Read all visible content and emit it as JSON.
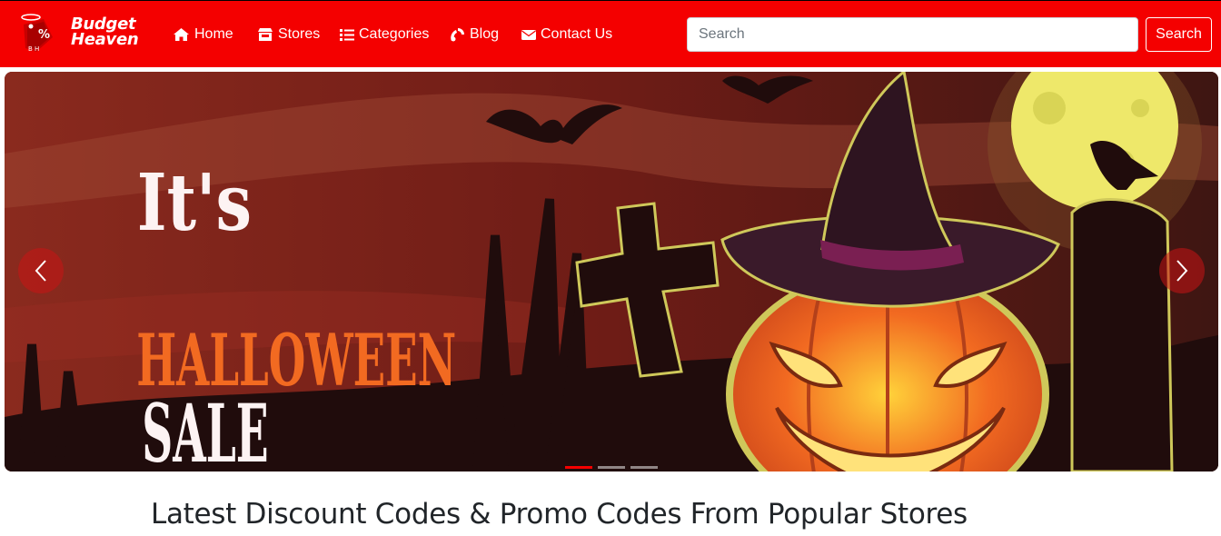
{
  "brand": {
    "line1": "Budget",
    "line2": "Heaven",
    "badge_symbol": "%",
    "badge_initials": "B H"
  },
  "nav": {
    "items": [
      {
        "label": "Home",
        "icon": "home-icon"
      },
      {
        "label": "Stores",
        "icon": "store-icon"
      },
      {
        "label": "Categories",
        "icon": "list-icon"
      },
      {
        "label": "Blog",
        "icon": "blog-icon"
      },
      {
        "label": "Contact Us",
        "icon": "envelope-icon"
      }
    ]
  },
  "search": {
    "placeholder": "Search",
    "value": "",
    "button_label": "Search"
  },
  "carousel": {
    "slide_text": {
      "line1": "It's",
      "line2": "HALLOWEEN",
      "line3": "SALE"
    },
    "prev_icon": "chevron-left-icon",
    "next_icon": "chevron-right-icon",
    "indicator_count": 3,
    "active_index": 0
  },
  "main": {
    "heading": "Latest Discount Codes & Promo Codes From Popular Stores"
  },
  "colors": {
    "brand_red": "#f40000",
    "slide_orange": "#f26a21",
    "slide_white": "#fdf3f3"
  }
}
